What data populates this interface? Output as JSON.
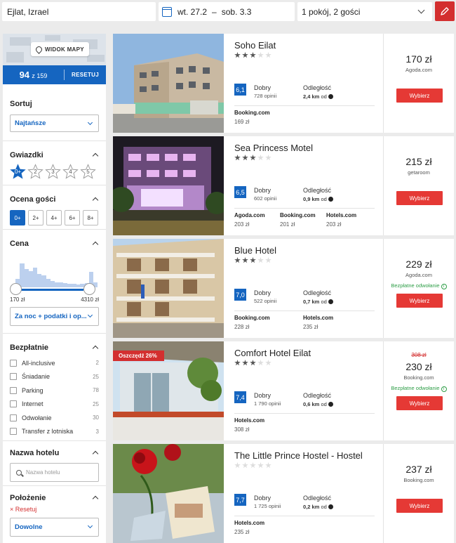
{
  "search": {
    "destination": "Ejlat, Izrael",
    "date_from": "wt. 27.2",
    "date_sep": "–",
    "date_to": "sob. 3.3",
    "guests": "1 pokój, 2 gości"
  },
  "sidebar": {
    "map_label": "WIDOK MAPY",
    "count": "94",
    "count_total": "z 159",
    "reset": "RESETUJ",
    "sort_title": "Sortuj",
    "sort_value": "Najtańsze",
    "stars_title": "Gwiazdki",
    "stars": [
      "0+",
      "2",
      "3",
      "4",
      "5"
    ],
    "rating_title": "Ocena gości",
    "ratings": [
      "0+",
      "2+",
      "4+",
      "6+",
      "8+"
    ],
    "price_title": "Cena",
    "price_min": "170 zł",
    "price_max": "4310 zł",
    "price_histogram": [
      0.25,
      0.7,
      0.55,
      0.47,
      0.58,
      0.4,
      0.35,
      0.25,
      0.18,
      0.15,
      0.15,
      0.12,
      0.1,
      0.1,
      0.08,
      0.1,
      0.12,
      0.45,
      0.15
    ],
    "price_mode": "Za noc + podatki i op...",
    "free_title": "Bezpłatnie",
    "free_items": [
      {
        "label": "All-inclusive",
        "count": "2"
      },
      {
        "label": "Śniadanie",
        "count": "25"
      },
      {
        "label": "Parking",
        "count": "78"
      },
      {
        "label": "Internet",
        "count": "25"
      },
      {
        "label": "Odwołanie",
        "count": "30"
      },
      {
        "label": "Transfer z lotniska",
        "count": "3"
      }
    ],
    "name_title": "Nazwa hotelu",
    "name_placeholder": "Nazwa hotelu",
    "location_title": "Położenie",
    "location_reset": "Resetuj",
    "location_value": "Dowolne"
  },
  "results": [
    {
      "name": "Soho Eilat",
      "stars": 3,
      "score": "6,1",
      "score_label": "Dobry",
      "reviews": "728 opinii",
      "distance_label": "Odległość",
      "distance": "2,4 km",
      "distance_suffix": "od",
      "offers": [
        {
          "provider": "Booking.com",
          "price": "169 zł"
        }
      ],
      "price": "170 zł",
      "old_price": "",
      "source": "Agoda.com",
      "free_cancel": "",
      "button": "Wybierz",
      "deal": ""
    },
    {
      "name": "Sea Princess Motel",
      "stars": 3,
      "score": "6,5",
      "score_label": "Dobry",
      "reviews": "602 opinii",
      "distance_label": "Odległość",
      "distance": "0,9 km",
      "distance_suffix": "od",
      "offers": [
        {
          "provider": "Agoda.com",
          "price": "203 zł"
        },
        {
          "provider": "Booking.com",
          "price": "201 zł"
        },
        {
          "provider": "Hotels.com",
          "price": "203 zł"
        }
      ],
      "price": "215 zł",
      "old_price": "",
      "source": "getaroom",
      "free_cancel": "",
      "button": "Wybierz",
      "deal": ""
    },
    {
      "name": "Blue Hotel",
      "stars": 3,
      "score": "7,0",
      "score_label": "Dobry",
      "reviews": "522 opinii",
      "distance_label": "Odległość",
      "distance": "0,7 km",
      "distance_suffix": "od",
      "offers": [
        {
          "provider": "Booking.com",
          "price": "228 zł"
        },
        {
          "provider": "Hotels.com",
          "price": "235 zł"
        }
      ],
      "price": "229 zł",
      "old_price": "",
      "source": "Agoda.com",
      "free_cancel": "Bezpłatne odwołanie",
      "button": "Wybierz",
      "deal": ""
    },
    {
      "name": "Comfort Hotel Eilat",
      "stars": 3,
      "score": "7,4",
      "score_label": "Dobry",
      "reviews": "1 790 opinii",
      "distance_label": "Odległość",
      "distance": "0,6 km",
      "distance_suffix": "od",
      "offers": [
        {
          "provider": "Hotels.com",
          "price": "308 zł"
        }
      ],
      "price": "230 zł",
      "old_price": "308 zł",
      "source": "Booking.com",
      "free_cancel": "Bezpłatne odwołanie",
      "button": "Wybierz",
      "deal": "Oszczędź 26%"
    },
    {
      "name": "The Little Prince Hostel - Hostel",
      "stars": 0,
      "score": "7,7",
      "score_label": "Dobry",
      "reviews": "1 725 opinii",
      "distance_label": "Odległość",
      "distance": "0,2 km",
      "distance_suffix": "od",
      "offers": [
        {
          "provider": "Hotels.com",
          "price": "235 zł"
        }
      ],
      "price": "237 zł",
      "old_price": "",
      "source": "Booking.com",
      "free_cancel": "",
      "button": "Wybierz",
      "deal": ""
    }
  ],
  "colors": {
    "accent": "#1565c0",
    "cta": "#e53935",
    "positive": "#2e9e47"
  }
}
